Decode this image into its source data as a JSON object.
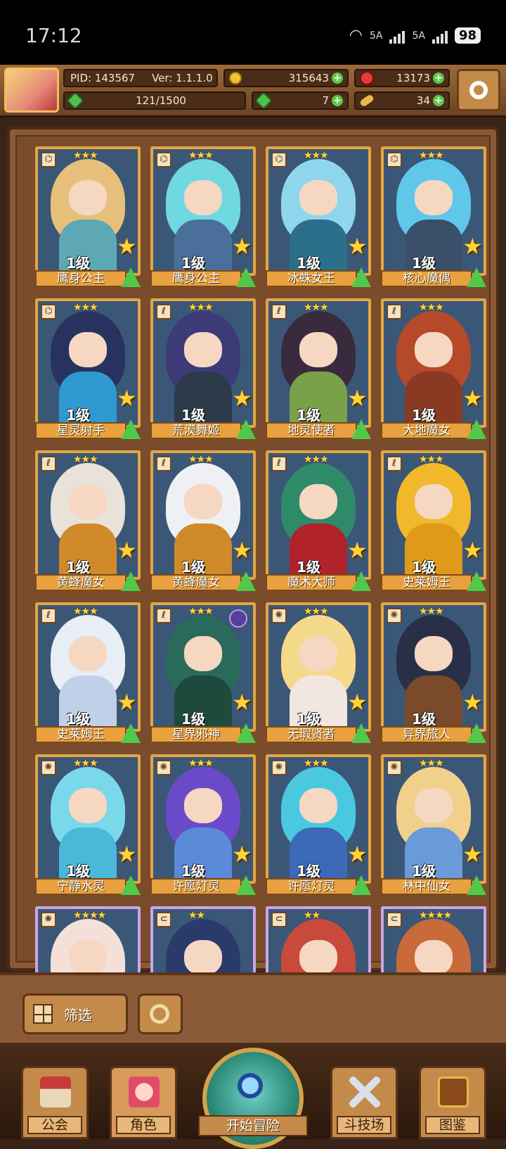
{
  "status_bar": {
    "time": "17:12",
    "net1": "5A",
    "net2": "5A",
    "battery": "98"
  },
  "hud": {
    "pid": "PID: 143567",
    "version": "Ver: 1.1.1.0",
    "gold": "315643",
    "gems": "13173",
    "stamina": "121/1500",
    "clover": "7",
    "bone": "34"
  },
  "cards": [
    {
      "name": "鹰身公主",
      "level": "1级",
      "stars": "★★★",
      "class": "bird",
      "palette": [
        "#e6c07a",
        "#5ea8b6"
      ]
    },
    {
      "name": "鹰身公主",
      "level": "1级",
      "stars": "★★★",
      "class": "bird",
      "palette": [
        "#6fd8e0",
        "#4a6f9a"
      ]
    },
    {
      "name": "冰蛛女王",
      "level": "1级",
      "stars": "★★★",
      "class": "bird",
      "palette": [
        "#8fd6ec",
        "#2c6f8a"
      ]
    },
    {
      "name": "核心魔偶",
      "level": "1级",
      "stars": "★★★",
      "class": "bird",
      "palette": [
        "#5fc8ea",
        "#3a4f6a"
      ]
    },
    {
      "name": "星灵射手",
      "level": "1级",
      "stars": "★★★",
      "class": "bird",
      "palette": [
        "#27325e",
        "#2f9ad0"
      ]
    },
    {
      "name": "荒漠舞姬",
      "level": "1级",
      "stars": "★★★",
      "class": "staff",
      "palette": [
        "#3d3a78",
        "#2c3a4a"
      ]
    },
    {
      "name": "地灵使者",
      "level": "1级",
      "stars": "★★★",
      "class": "staff",
      "palette": [
        "#3a2a3e",
        "#7aa04a"
      ]
    },
    {
      "name": "大地魔女",
      "level": "1级",
      "stars": "★★★",
      "class": "staff",
      "palette": [
        "#b5492a",
        "#8a3a22"
      ]
    },
    {
      "name": "黄蜂魔女",
      "level": "1级",
      "stars": "★★★",
      "class": "staff",
      "palette": [
        "#e8e2d8",
        "#d08a2a"
      ]
    },
    {
      "name": "黄蜂魔女",
      "level": "1级",
      "stars": "★★★",
      "class": "staff",
      "palette": [
        "#eef0f4",
        "#d08a2a"
      ]
    },
    {
      "name": "魔术大师",
      "level": "1级",
      "stars": "★★★",
      "class": "staff",
      "palette": [
        "#2f8a6a",
        "#b0232a"
      ]
    },
    {
      "name": "史莱姆王",
      "level": "1级",
      "stars": "★★★",
      "class": "staff",
      "palette": [
        "#f0b82a",
        "#e09a1a"
      ]
    },
    {
      "name": "史莱姆王",
      "level": "1级",
      "stars": "★★★",
      "class": "staff",
      "palette": [
        "#e8eef6",
        "#c0d0e8"
      ]
    },
    {
      "name": "星界邪神",
      "level": "1级",
      "stars": "★★★",
      "class": "staff",
      "palette": [
        "#2a6a5a",
        "#1e4a3e"
      ],
      "badge": true
    },
    {
      "name": "无瑕贤者",
      "level": "1级",
      "stars": "★★★",
      "class": "sun",
      "palette": [
        "#f4d98a",
        "#f2e6e0"
      ]
    },
    {
      "name": "异界旅人",
      "level": "1级",
      "stars": "★★★",
      "class": "sun",
      "palette": [
        "#2a2f48",
        "#7a4a2a"
      ]
    },
    {
      "name": "宁静水灵",
      "level": "1级",
      "stars": "★★★",
      "class": "sun",
      "palette": [
        "#7ad8ea",
        "#4ab8d8"
      ]
    },
    {
      "name": "许愿灯灵",
      "level": "1级",
      "stars": "★★★",
      "class": "sun",
      "palette": [
        "#6a4ac8",
        "#5a8ad8"
      ]
    },
    {
      "name": "许愿灯灵",
      "level": "1级",
      "stars": "★★★",
      "class": "sun",
      "palette": [
        "#4ac8e0",
        "#3a6ab8"
      ]
    },
    {
      "name": "林中仙女",
      "level": "1级",
      "stars": "★★★",
      "class": "sun",
      "palette": [
        "#f0d08a",
        "#6a9ad8"
      ]
    },
    {
      "name": "",
      "level": "",
      "stars": "★★★★",
      "class": "sun",
      "palette": [
        "#f4e0d8",
        "#e8a8b8"
      ],
      "purple": true
    },
    {
      "name": "",
      "level": "",
      "stars": "★★",
      "class": "bone",
      "palette": [
        "#2a3a6a",
        "#4a7a4a"
      ],
      "purple": true
    },
    {
      "name": "",
      "level": "",
      "stars": "★★",
      "class": "bone",
      "palette": [
        "#c84a3a",
        "#6a2a22"
      ],
      "purple": true
    },
    {
      "name": "",
      "level": "",
      "stars": "★★★★",
      "class": "bone",
      "palette": [
        "#c86a3a",
        "#8a4a2a"
      ],
      "purple": true
    }
  ],
  "toolbar": {
    "filter_label": "筛选"
  },
  "nav": {
    "guild": "公会",
    "character": "角色",
    "adventure": "开始冒险",
    "arena": "斗技场",
    "codex": "图鉴"
  }
}
